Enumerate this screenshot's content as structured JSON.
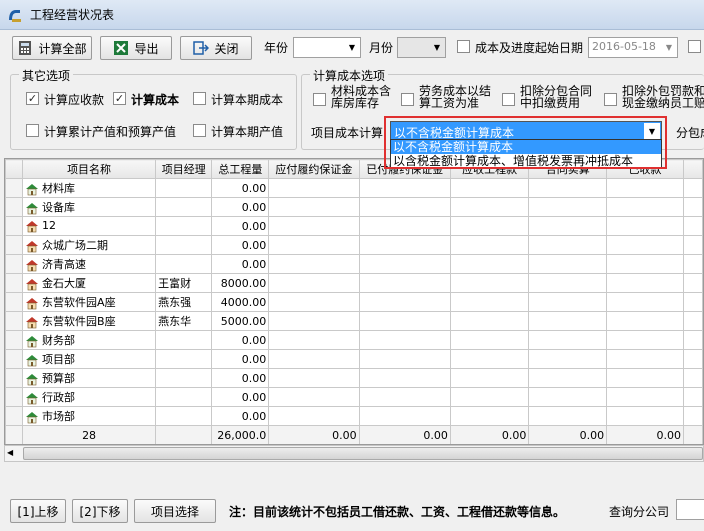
{
  "window": {
    "title": "工程经营状况表"
  },
  "toolbar": {
    "calc_all": "计算全部",
    "export": "导出",
    "close": "关闭",
    "year_label": "年份",
    "year_value": "",
    "month_label": "月份",
    "month_value": "",
    "cost_start_label": "成本及进度起始日期",
    "cost_start_value": "2016-05-18"
  },
  "other_options": {
    "title": "其它选项",
    "calc_receivable": {
      "label": "计算应收款",
      "checked": true
    },
    "calc_cost": {
      "label": "计算成本",
      "checked": true
    },
    "calc_period_cost": {
      "label": "计算本期成本",
      "checked": false
    },
    "calc_cumulative": {
      "label": "计算累计产值和预算产值",
      "checked": false
    },
    "calc_period_output": {
      "label": "计算本期产值",
      "checked": false
    }
  },
  "cost_options": {
    "title": "计算成本选项",
    "material_cost_line1": "材料成本含",
    "material_cost_line2": "库房库存",
    "labor_cost_line1": "劳务成本以结",
    "labor_cost_line2": "算工资为准",
    "deduct_sub_line1": "扣除分包合同",
    "deduct_sub_line2": "中扣缴费用",
    "deduct_ext_line1": "扣除外包罚款和",
    "deduct_ext_line2": "现金缴纳员工赔",
    "project_cost_label": "项目成本计算",
    "project_cost_value": "以不含税金额计算成本",
    "branch_cost_label": "分包成",
    "dropdown_options": [
      "以不含税金额计算成本",
      "以含税金额计算成本、增值税发票再冲抵成本"
    ],
    "dropdown_selected": 0
  },
  "grid": {
    "columns": [
      "项目名称",
      "项目经理",
      "总工程量",
      "应付履约保证金",
      "已付履约保证金",
      "应收工程款",
      "合同实算",
      "已收款"
    ],
    "rows": [
      {
        "icon": "house-green",
        "name": "材料库",
        "manager": "",
        "qty": "0.00"
      },
      {
        "icon": "house-green",
        "name": "设备库",
        "manager": "",
        "qty": "0.00"
      },
      {
        "icon": "house-red",
        "name": "12",
        "manager": "",
        "qty": "0.00"
      },
      {
        "icon": "house-red",
        "name": "众城广场二期",
        "manager": "",
        "qty": "0.00"
      },
      {
        "icon": "house-red",
        "name": "济青高速",
        "manager": "",
        "qty": "0.00"
      },
      {
        "icon": "house-red",
        "name": "金石大厦",
        "manager": "王富财",
        "qty": "8000.00"
      },
      {
        "icon": "house-red",
        "name": "东营软件园A座",
        "manager": "燕东强",
        "qty": "4000.00"
      },
      {
        "icon": "house-red",
        "name": "东营软件园B座",
        "manager": "燕东华",
        "qty": "5000.00"
      },
      {
        "icon": "house-green",
        "name": "财务部",
        "manager": "",
        "qty": "0.00"
      },
      {
        "icon": "house-green",
        "name": "项目部",
        "manager": "",
        "qty": "0.00"
      },
      {
        "icon": "house-green",
        "name": "预算部",
        "manager": "",
        "qty": "0.00"
      },
      {
        "icon": "house-green",
        "name": "行政部",
        "manager": "",
        "qty": "0.00"
      },
      {
        "icon": "house-green",
        "name": "市场部",
        "manager": "",
        "qty": "0.00"
      }
    ],
    "totals": {
      "count": "28",
      "qty": "26,000.0",
      "c4": "0.00",
      "c5": "0.00",
      "c6": "0.00",
      "c7": "0.00",
      "c8": "0.00"
    }
  },
  "bottom": {
    "move_up": "[1]上移",
    "move_down": "[2]下移",
    "select_project": "项目选择",
    "note": "注：目前该统计不包括员工借还款、工资、工程借还款等信息。",
    "query_branch": "查询分公司"
  },
  "colors": {
    "accent_selection": "#3399ff",
    "highlight_red": "#e03030"
  }
}
